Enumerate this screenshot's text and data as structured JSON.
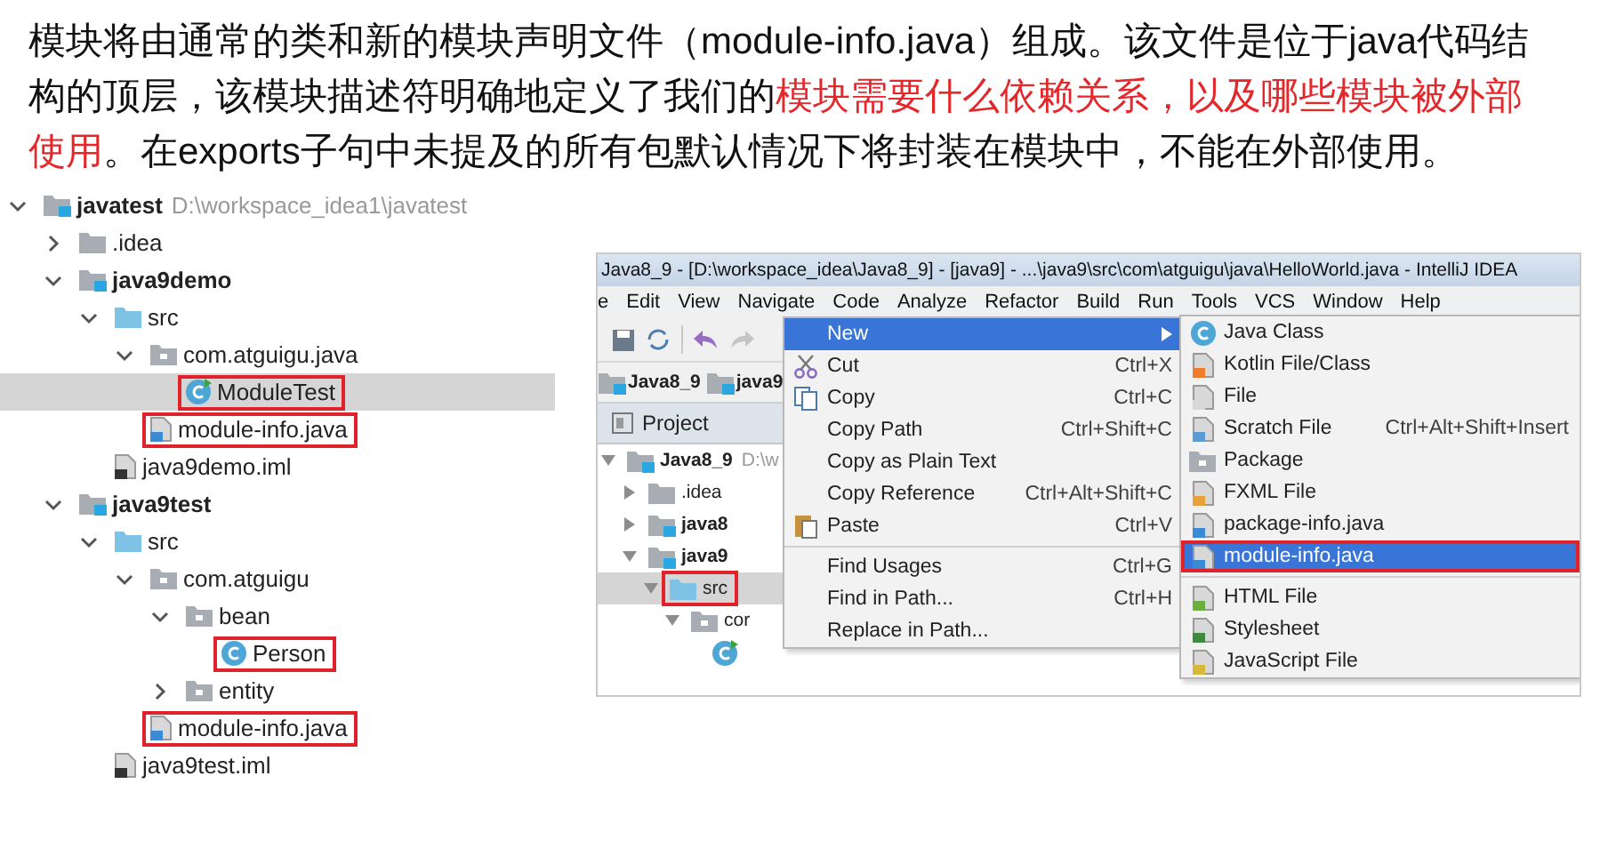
{
  "paragraph": {
    "segments": [
      {
        "text": "模块将由通常的类和新的模块声明文件（module-info.java）组成。该文件是位于java代码结构的顶层，该模块描述符明确地定义了我们的",
        "highlight": false
      },
      {
        "text": "模块需要什么依赖关系，以及哪些模块被外部使用",
        "highlight": true
      },
      {
        "text": "。在exports子句中未提及的所有包默认情况下将封装在模块中，不能在外部使用。",
        "highlight": false
      }
    ]
  },
  "project_tree": {
    "items": [
      {
        "label": "javatest",
        "kind": "module",
        "path": "D:\\workspace_idea1\\javatest",
        "expanded": true,
        "selected": false,
        "boxed": false,
        "children": [
          {
            "label": ".idea",
            "kind": "folder",
            "expanded": false,
            "selected": false,
            "boxed": false
          },
          {
            "label": "java9demo",
            "kind": "module",
            "expanded": true,
            "selected": false,
            "boxed": false,
            "children": [
              {
                "label": "src",
                "kind": "source-folder",
                "expanded": true,
                "selected": false,
                "boxed": false,
                "children": [
                  {
                    "label": "com.atguigu.java",
                    "kind": "package",
                    "expanded": true,
                    "selected": false,
                    "boxed": false,
                    "children": [
                      {
                        "label": "ModuleTest",
                        "kind": "class-run",
                        "selected": true,
                        "boxed": true
                      }
                    ]
                  },
                  {
                    "label": "module-info.java",
                    "kind": "java-file",
                    "selected": false,
                    "boxed": true
                  }
                ]
              },
              {
                "label": "java9demo.iml",
                "kind": "iml",
                "selected": false,
                "boxed": false
              }
            ]
          },
          {
            "label": "java9test",
            "kind": "module",
            "expanded": true,
            "selected": false,
            "boxed": false,
            "children": [
              {
                "label": "src",
                "kind": "source-folder",
                "expanded": true,
                "selected": false,
                "boxed": false,
                "children": [
                  {
                    "label": "com.atguigu",
                    "kind": "package",
                    "expanded": true,
                    "selected": false,
                    "boxed": false,
                    "children": [
                      {
                        "label": "bean",
                        "kind": "package",
                        "expanded": true,
                        "selected": false,
                        "boxed": false,
                        "children": [
                          {
                            "label": "Person",
                            "kind": "class",
                            "selected": false,
                            "boxed": true
                          }
                        ]
                      },
                      {
                        "label": "entity",
                        "kind": "package",
                        "expanded": false,
                        "selected": false,
                        "boxed": false
                      }
                    ]
                  },
                  {
                    "label": "module-info.java",
                    "kind": "java-file",
                    "selected": false,
                    "boxed": true
                  }
                ]
              },
              {
                "label": "java9test.iml",
                "kind": "iml",
                "selected": false,
                "boxed": false
              }
            ]
          }
        ]
      }
    ]
  },
  "ide": {
    "title": "Java8_9 - [D:\\workspace_idea\\Java8_9] - [java9] - ...\\java9\\src\\com\\atguigu\\java\\HelloWorld.java - IntelliJ IDEA",
    "menu_bar": [
      "e",
      "Edit",
      "View",
      "Navigate",
      "Code",
      "Analyze",
      "Refactor",
      "Build",
      "Run",
      "Tools",
      "VCS",
      "Window",
      "Help"
    ],
    "breadcrumbs": [
      "Java8_9",
      "java9"
    ],
    "tool_window": "Project",
    "tree": {
      "items": [
        {
          "label": "Java8_9",
          "kind": "module",
          "path": "D:\\w",
          "expanded": true,
          "selected": false,
          "boxed": false,
          "children": [
            {
              "label": ".idea",
              "kind": "folder",
              "expanded": false,
              "selected": false,
              "boxed": false
            },
            {
              "label": "java8",
              "kind": "module",
              "expanded": false,
              "selected": false,
              "boxed": false
            },
            {
              "label": "java9",
              "kind": "module",
              "expanded": true,
              "selected": false,
              "boxed": false,
              "children": [
                {
                  "label": "src",
                  "kind": "source-folder",
                  "expanded": true,
                  "selected": true,
                  "boxed": true,
                  "children": [
                    {
                      "label": "cor",
                      "kind": "package",
                      "expanded": true,
                      "selected": false,
                      "boxed": false,
                      "children": [
                        {
                          "kind": "class-run",
                          "selected": false,
                          "boxed": false
                        }
                      ]
                    }
                  ]
                }
              ]
            }
          ]
        }
      ]
    },
    "context_menu": [
      {
        "kind": "submenu",
        "label": "New",
        "selected": true
      },
      {
        "kind": "cut",
        "label": "Cut",
        "shortcut": "Ctrl+X",
        "selected": false
      },
      {
        "kind": "copy",
        "label": "Copy",
        "shortcut": "Ctrl+C",
        "selected": false
      },
      {
        "kind": "plain",
        "label": "Copy Path",
        "shortcut": "Ctrl+Shift+C",
        "selected": false
      },
      {
        "kind": "plain",
        "label": "Copy as Plain Text",
        "selected": false
      },
      {
        "kind": "plain",
        "label": "Copy Reference",
        "shortcut": "Ctrl+Alt+Shift+C",
        "selected": false
      },
      {
        "kind": "paste",
        "label": "Paste",
        "shortcut": "Ctrl+V",
        "selected": false
      },
      {
        "kind": "separator"
      },
      {
        "kind": "plain",
        "label": "Find Usages",
        "shortcut": "Ctrl+G",
        "selected": false
      },
      {
        "kind": "plain",
        "label": "Find in Path...",
        "shortcut": "Ctrl+H",
        "selected": false
      },
      {
        "kind": "plain",
        "label": "Replace in Path...",
        "selected": false
      }
    ],
    "submenu": [
      {
        "kind": "class",
        "label": "Java Class",
        "selected": false,
        "boxed": false
      },
      {
        "kind": "kotlin",
        "label": "Kotlin File/Class",
        "selected": false,
        "boxed": false
      },
      {
        "kind": "file",
        "label": "File",
        "selected": false,
        "boxed": false
      },
      {
        "kind": "scratch",
        "label": "Scratch File",
        "shortcut": "Ctrl+Alt+Shift+Insert",
        "selected": false,
        "boxed": false
      },
      {
        "kind": "package",
        "label": "Package",
        "selected": false,
        "boxed": false
      },
      {
        "kind": "fxml",
        "label": "FXML File",
        "selected": false,
        "boxed": false
      },
      {
        "kind": "java-file",
        "label": "package-info.java",
        "selected": false,
        "boxed": false
      },
      {
        "kind": "java-file",
        "label": "module-info.java",
        "selected": true,
        "boxed": true
      },
      {
        "kind": "separator"
      },
      {
        "kind": "html",
        "label": "HTML File",
        "selected": false,
        "boxed": false
      },
      {
        "kind": "css",
        "label": "Stylesheet",
        "selected": false,
        "boxed": false
      },
      {
        "kind": "js",
        "label": "JavaScript File",
        "selected": false,
        "boxed": false
      }
    ]
  }
}
